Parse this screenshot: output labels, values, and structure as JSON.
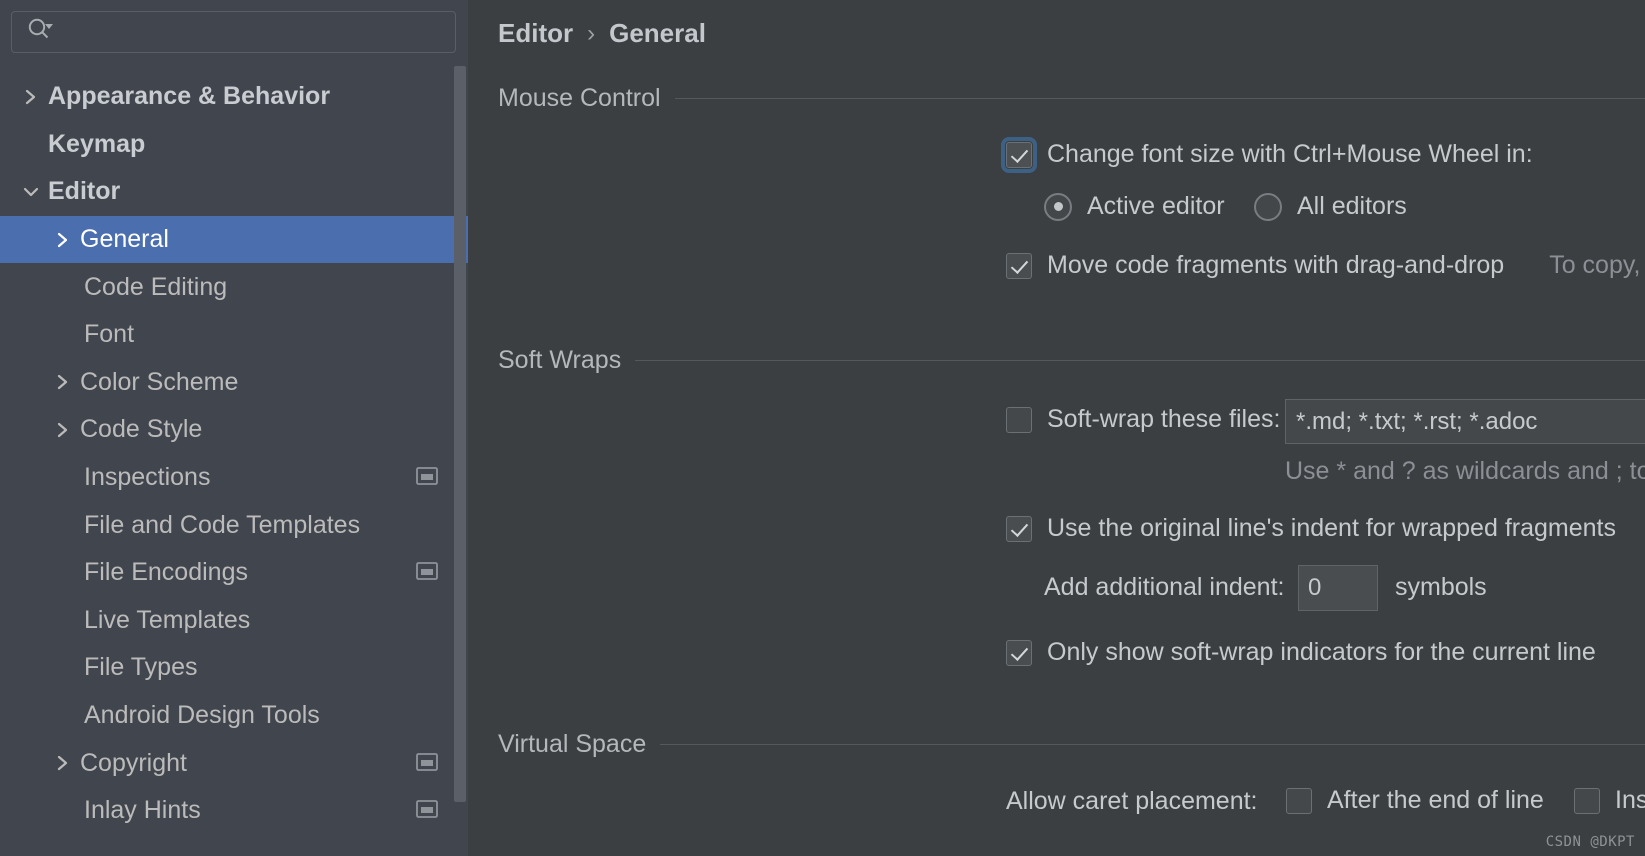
{
  "search": {
    "value": "",
    "placeholder": "",
    "icon": "search-icon"
  },
  "sidebar": {
    "items": [
      {
        "label": "Appearance & Behavior",
        "level": 0,
        "arrow": "collapsed",
        "bold": true,
        "scope_icon": false,
        "selected": false
      },
      {
        "label": "Keymap",
        "level": 0,
        "arrow": "none",
        "bold": true,
        "scope_icon": false,
        "selected": false
      },
      {
        "label": "Editor",
        "level": 0,
        "arrow": "expanded",
        "bold": true,
        "scope_icon": false,
        "selected": false
      },
      {
        "label": "General",
        "level": 1,
        "arrow": "collapsed",
        "bold": false,
        "scope_icon": false,
        "selected": true
      },
      {
        "label": "Code Editing",
        "level": 1,
        "arrow": "none",
        "bold": false,
        "scope_icon": false,
        "selected": false
      },
      {
        "label": "Font",
        "level": 1,
        "arrow": "none",
        "bold": false,
        "scope_icon": false,
        "selected": false
      },
      {
        "label": "Color Scheme",
        "level": 1,
        "arrow": "collapsed",
        "bold": false,
        "scope_icon": false,
        "selected": false
      },
      {
        "label": "Code Style",
        "level": 1,
        "arrow": "collapsed",
        "bold": false,
        "scope_icon": false,
        "selected": false
      },
      {
        "label": "Inspections",
        "level": 1,
        "arrow": "none",
        "bold": false,
        "scope_icon": true,
        "selected": false
      },
      {
        "label": "File and Code Templates",
        "level": 1,
        "arrow": "none",
        "bold": false,
        "scope_icon": false,
        "selected": false
      },
      {
        "label": "File Encodings",
        "level": 1,
        "arrow": "none",
        "bold": false,
        "scope_icon": true,
        "selected": false
      },
      {
        "label": "Live Templates",
        "level": 1,
        "arrow": "none",
        "bold": false,
        "scope_icon": false,
        "selected": false
      },
      {
        "label": "File Types",
        "level": 1,
        "arrow": "none",
        "bold": false,
        "scope_icon": false,
        "selected": false
      },
      {
        "label": "Android Design Tools",
        "level": 1,
        "arrow": "none",
        "bold": false,
        "scope_icon": false,
        "selected": false
      },
      {
        "label": "Copyright",
        "level": 1,
        "arrow": "collapsed",
        "bold": false,
        "scope_icon": true,
        "selected": false
      },
      {
        "label": "Inlay Hints",
        "level": 1,
        "arrow": "none",
        "bold": false,
        "scope_icon": true,
        "selected": false
      }
    ]
  },
  "breadcrumb": {
    "parent": "Editor",
    "separator": "›",
    "current": "General"
  },
  "sections": {
    "mouse_control": {
      "title": "Mouse Control",
      "change_font_size": {
        "label": "Change font size with Ctrl+Mouse Wheel in:",
        "checked": true,
        "focused": true
      },
      "radios": [
        {
          "label": "Active editor",
          "selected": true
        },
        {
          "label": "All editors",
          "selected": false
        }
      ],
      "drag_and_drop": {
        "label": "Move code fragments with drag-and-drop",
        "checked": true,
        "hint": "To copy, hold Ctrl while dragging"
      }
    },
    "soft_wraps": {
      "title": "Soft Wraps",
      "soft_wrap_files": {
        "label": "Soft-wrap these files:",
        "checked": false,
        "value": "*.md; *.txt; *.rst; *.adoc",
        "placeholder": "",
        "hint": "Use * and ? as wildcards and ; to separate patterns"
      },
      "original_indent": {
        "label": "Use the original line's indent for wrapped fragments",
        "checked": true
      },
      "additional_indent": {
        "label": "Add additional indent:",
        "value": "0",
        "unit": "symbols"
      },
      "show_indicators": {
        "label": "Only show soft-wrap indicators for the current line",
        "checked": true
      }
    },
    "virtual_space": {
      "title": "Virtual Space",
      "caret_label": "Allow caret placement:",
      "options": [
        {
          "label": "After the end of line",
          "checked": false
        },
        {
          "label": "Inside tabs",
          "checked": false
        }
      ]
    }
  },
  "watermark": "CSDN @DKPT",
  "colors": {
    "sidebar_bg": "#41454d",
    "content_bg": "#3c3f41",
    "selection": "#4b6eaf",
    "text": "#c6cacd",
    "muted": "#8b9096",
    "focus_ring": "#3d6185"
  }
}
